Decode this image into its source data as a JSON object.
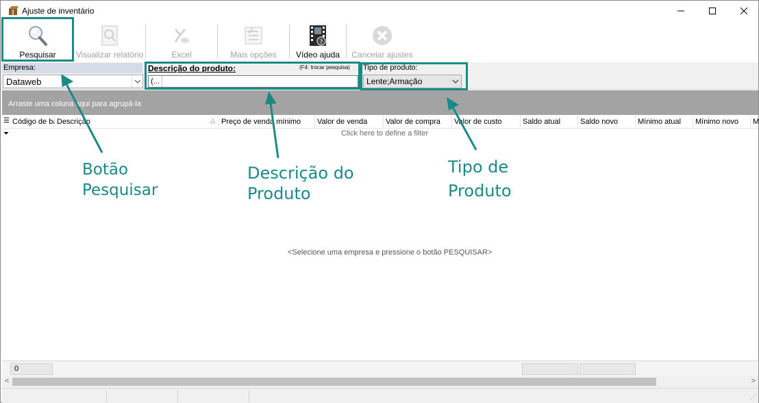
{
  "window": {
    "title": "Ajuste de inventário"
  },
  "toolbar": {
    "buttons": [
      {
        "label": "Pesquisar",
        "icon": "magnifier-icon",
        "enabled": true
      },
      {
        "label": "Visualizar relatório",
        "icon": "report-icon",
        "enabled": false
      },
      {
        "label": "Excel",
        "icon": "excel-icon",
        "enabled": false
      },
      {
        "label": "Mais opções",
        "icon": "checklist-icon",
        "enabled": false
      },
      {
        "label": "Vídeo ajuda",
        "icon": "film-help-icon",
        "enabled": true
      },
      {
        "label": "Cancelar ajustes",
        "icon": "cancel-icon",
        "enabled": false
      }
    ]
  },
  "filters": {
    "empresa_label": "Empresa:",
    "empresa_value": "Dataweb",
    "descricao_label": "Descrição do produto:",
    "descricao_hint": "(F4: trocar pesquisa)",
    "descricao_prefix": "(...",
    "descricao_value": "",
    "tipo_label": "Tipo de produto:",
    "tipo_value": "Lente;Armação"
  },
  "grid": {
    "group_panel_text": "Arraste uma coluna aqui para agrupá-la",
    "columns": [
      "Código de ba",
      "Descrição",
      "Preço de venda mínimo",
      "Valor de venda",
      "Valor de compra",
      "Valor de custo",
      "Saldo atual",
      "Saldo novo",
      "Mínimo atual",
      "Mínimo novo",
      "M"
    ],
    "filter_hint": "Click here to define a filter",
    "empty_message": "<Selecione uma empresa e pressione o botão PESQUISAR>",
    "footer_count": "0"
  },
  "annotations": {
    "pesquisar_line1": "Botão",
    "pesquisar_line2": "Pesquisar",
    "descricao_line1": "Descrição do",
    "descricao_line2": "Produto",
    "tipo_line1": "Tipo de",
    "tipo_line2": "Produto",
    "color": "#1a8a87"
  }
}
